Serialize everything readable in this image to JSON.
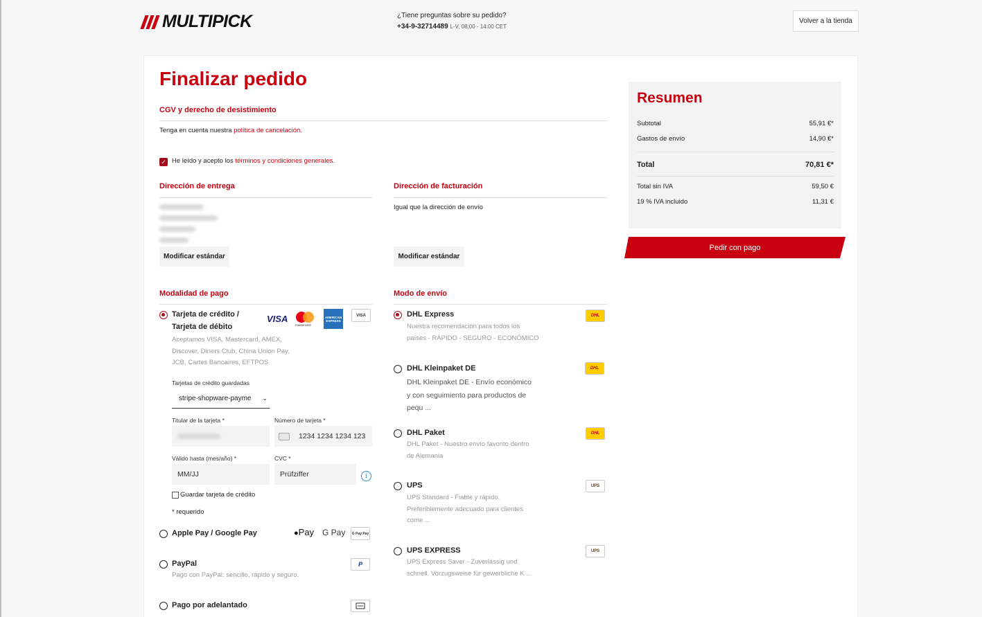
{
  "header": {
    "logo_text": "MULTIPICK",
    "help_question": "¿Tiene preguntas sobre su pedido?",
    "phone": "+34-9-32714489",
    "hours": "L-V, 08:00 - 14:00 CET",
    "back_button": "Volver a la tienda"
  },
  "page_title": "Finalizar pedido",
  "terms": {
    "heading": "CGV y derecho de desistimiento",
    "note_prefix": "Tenga en cuenta nuestra ",
    "note_link": "política de cancelación",
    "note_suffix": ".",
    "accept_prefix": "He leído y acepto los ",
    "accept_link": "términos y condiciones generales",
    "accept_suffix": ".",
    "accepted": true
  },
  "delivery_address": {
    "heading": "Dirección de entrega",
    "button": "Modificar estándar"
  },
  "billing_address": {
    "heading": "Dirección de facturación",
    "text": "Igual que la dirección de envío",
    "button": "Modificar estándar"
  },
  "payment": {
    "heading": "Modalidad de pago",
    "card": {
      "title_line1": "Tarjeta de crédito /",
      "title_line2": "Tarjeta de débito",
      "desc_lines": [
        "Aceptamos VISA, Mastercard, AMEX,",
        "Discover, Diners Club, China Union Pay,",
        "JCB, Cartes Bancaires, EFTPOS"
      ],
      "saved_label": "Tarjetas de crédito guardadas",
      "saved_value": "stripe-shopware-payme",
      "holder_label": "Titular de la tarjeta *",
      "number_label": "Número de tarjeta *",
      "number_placeholder": "1234 1234 1234 123",
      "expiry_label": "Válido hasta (mes/año) *",
      "expiry_placeholder": "MM/JJ",
      "cvc_label": "CVC *",
      "cvc_placeholder": "Prüfziffer",
      "save_card_label": "Guardar tarjeta de crédito",
      "required_note": "* requerido",
      "brands": {
        "visa": "VISA",
        "mastercard": "mastercard",
        "amex": "AMERICAN EXPRESS",
        "visa_small": "VISA"
      }
    },
    "applepay": {
      "title": "Apple Pay / Google Pay",
      "apple_logo": "Pay",
      "google_logo": "G Pay",
      "icon_text": "G Pay Pay"
    },
    "paypal": {
      "title": "PayPal",
      "desc": "Pago con PayPal: sencillo, rápido y seguro.",
      "icon": "P"
    },
    "prepay": {
      "title": "Pago por adelantado"
    }
  },
  "shipping": {
    "heading": "Modo de envío",
    "options": [
      {
        "title": "DHL Express",
        "desc_lines": [
          "Nuestra recomendación para todos los",
          "países - RÁPIDO - SEGURO - ECONÓMICO"
        ],
        "logo": "DHL",
        "selected": true
      },
      {
        "title": "DHL Kleinpaket DE",
        "desc_lines": [
          "DHL Kleinpaket DE - Envío económico",
          "y con seguimiento para productos de",
          "pequ ..."
        ],
        "logo": "DHL",
        "selected": false
      },
      {
        "title": "DHL Paket",
        "desc_lines": [
          "DHL Paket - Nuestro envío favorito dentro",
          "de Alemania"
        ],
        "logo": "DHL",
        "selected": false
      },
      {
        "title": "UPS",
        "desc_lines": [
          "UPS Standard - Fiable y rápido.",
          "Preferiblemente adecuado para clientes",
          "come ..."
        ],
        "logo": "UPS",
        "selected": false
      },
      {
        "title": "UPS EXPRESS",
        "desc_lines": [
          "UPS Express Saver - Zuverlässig und",
          "schnell. Vorzugsweise für gewerbliche K ..."
        ],
        "logo": "UPS",
        "selected": false
      }
    ]
  },
  "summary": {
    "title": "Resumen",
    "subtotal_label": "Subtotal",
    "subtotal": "55,91 €*",
    "shipping_label": "Gastos de envío",
    "shipping": "14,90 €*",
    "total_label": "Total",
    "total": "70,81 €*",
    "net_label": "Total sin IVA",
    "net": "59,50 €",
    "vat_label": "19 % IVA incluido",
    "vat": "11,31 €",
    "pay_button": "Pedir con pago"
  },
  "colors": {
    "brand_red": "#c8000f",
    "radio_red": "#a6081a"
  }
}
